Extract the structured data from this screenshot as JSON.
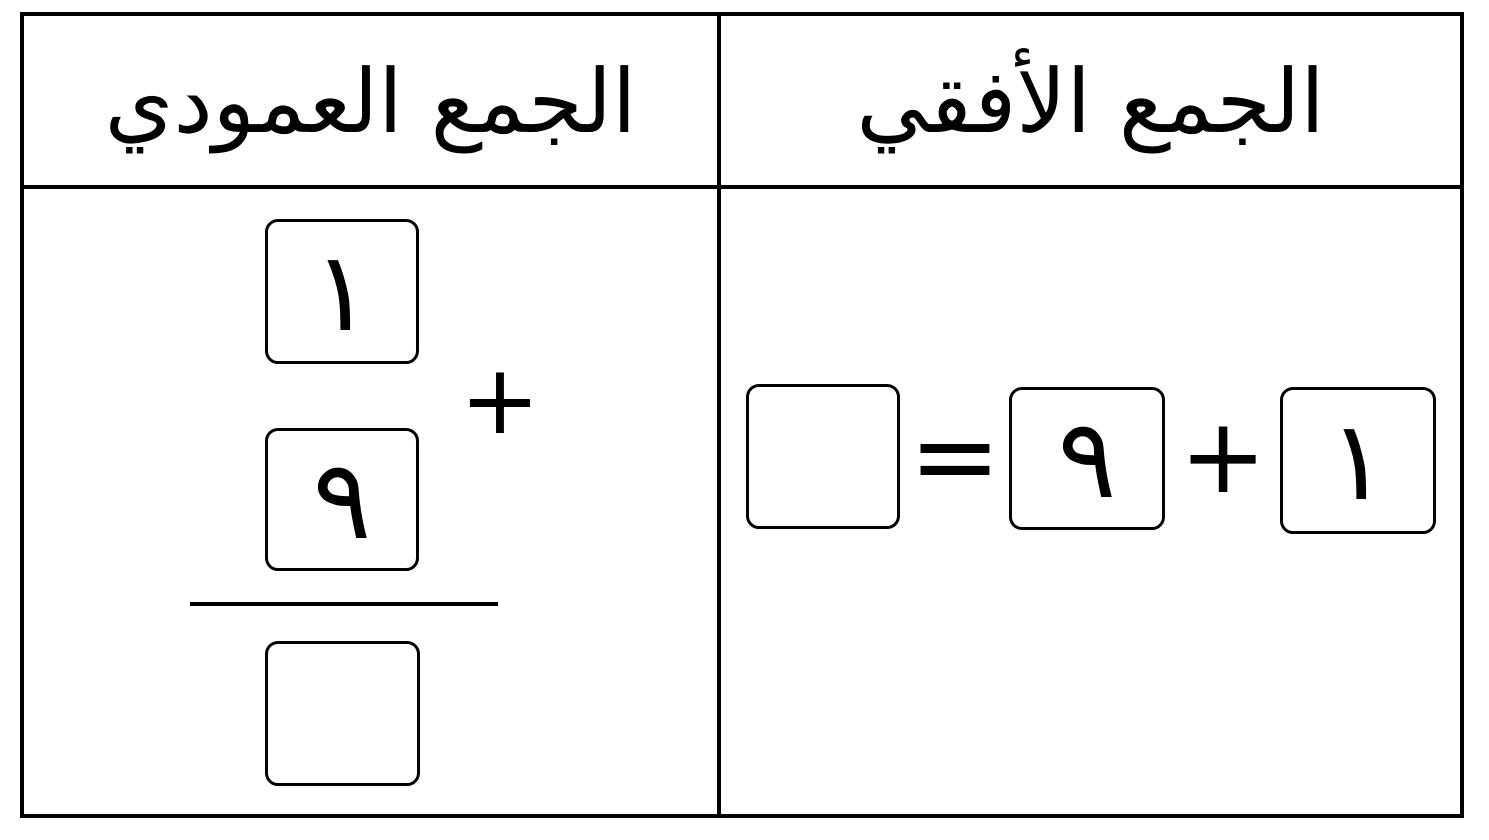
{
  "table": {
    "headers": {
      "horizontal": "الجمع الأفقي",
      "vertical": "الجمع العمودي"
    }
  },
  "horizontal_addition": {
    "first_number": "١",
    "plus_sign": "+",
    "second_number": "٩",
    "equals_sign": "=",
    "answer": ""
  },
  "vertical_addition": {
    "top_number": "١",
    "plus_sign": "+",
    "bottom_number": "٩",
    "answer": ""
  }
}
